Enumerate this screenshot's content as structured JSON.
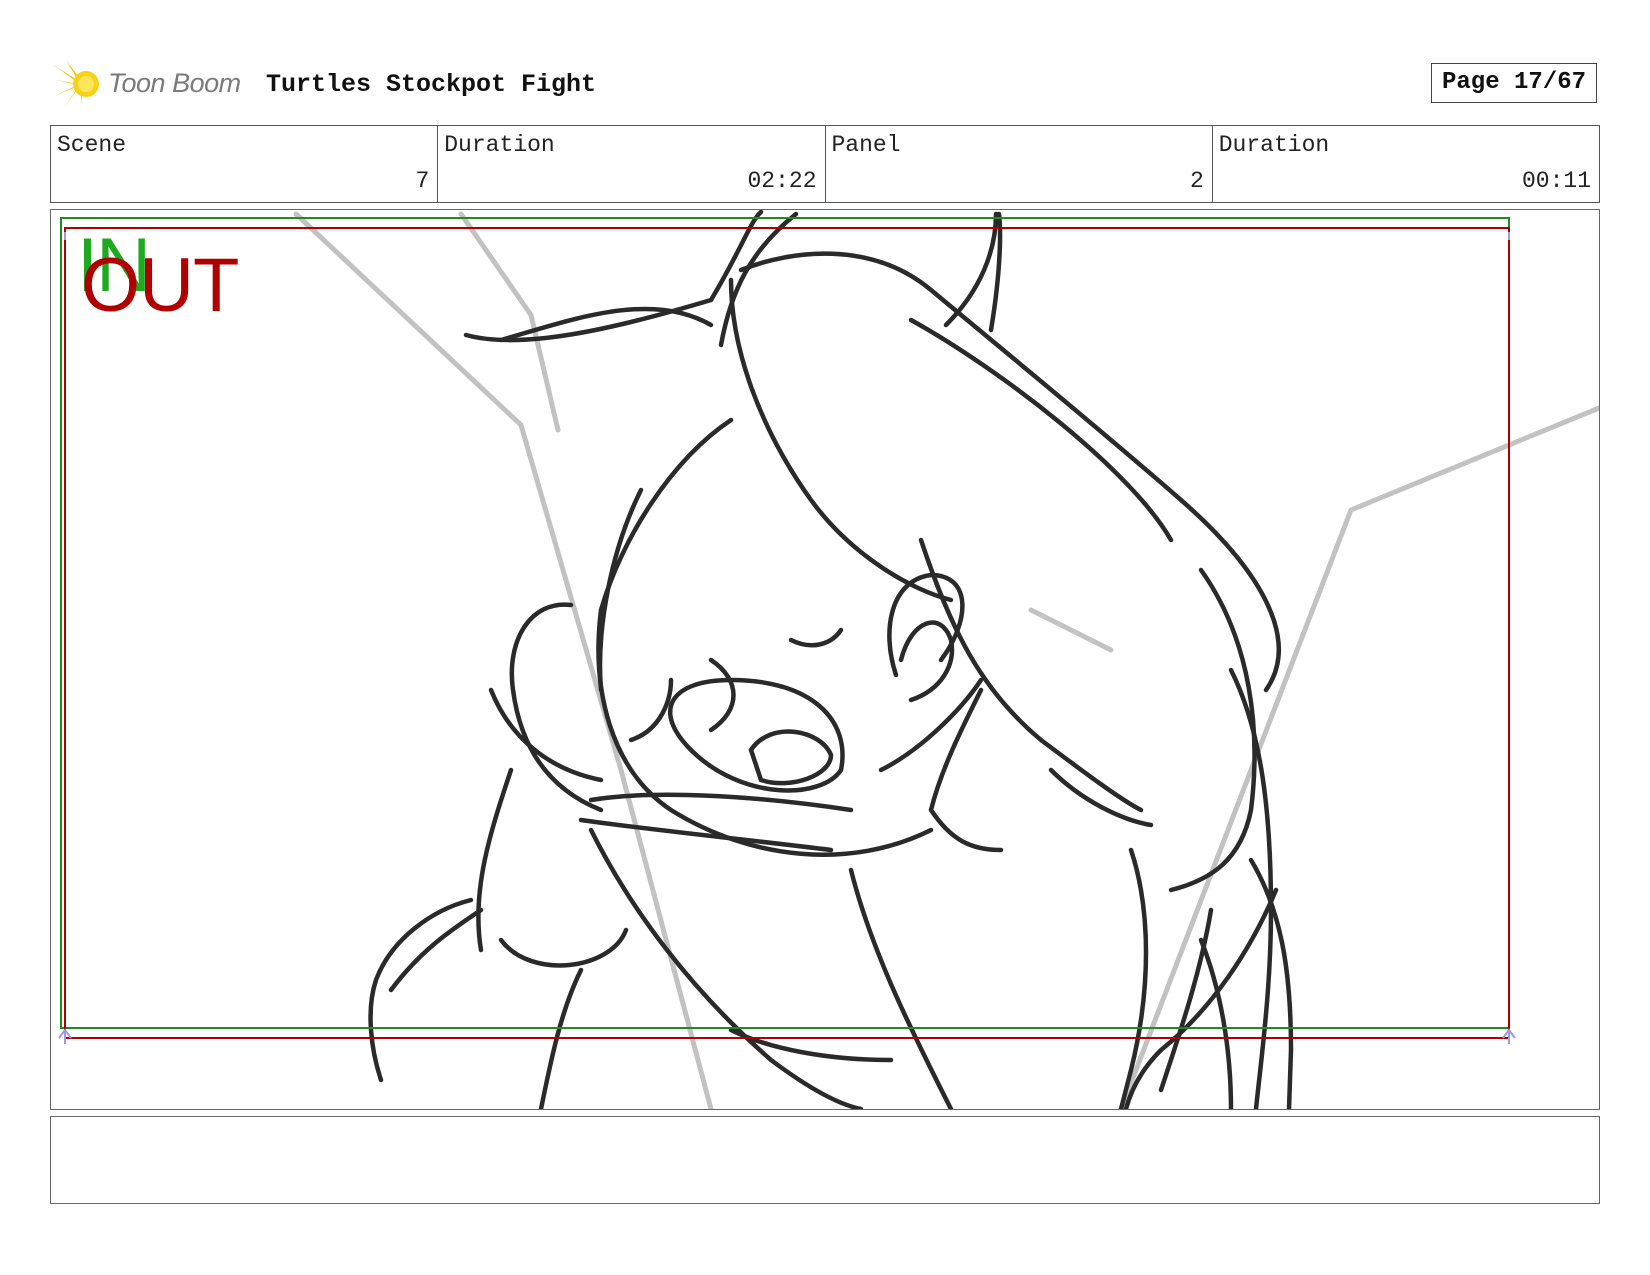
{
  "header": {
    "logo_text": "Toon Boom",
    "project_title": "Turtles Stockpot Fight",
    "page_label": "Page 17/67"
  },
  "info": {
    "scene_label": "Scene",
    "scene_value": "7",
    "scene_duration_label": "Duration",
    "scene_duration_value": "02:22",
    "panel_label": "Panel",
    "panel_value": "2",
    "panel_duration_label": "Duration",
    "panel_duration_value": "00:11"
  },
  "panel": {
    "in_marker": "IN",
    "out_marker": "OUT",
    "in_frame_color": "#1e8c1e",
    "out_frame_color": "#b00000"
  },
  "notes": {
    "text": ""
  }
}
